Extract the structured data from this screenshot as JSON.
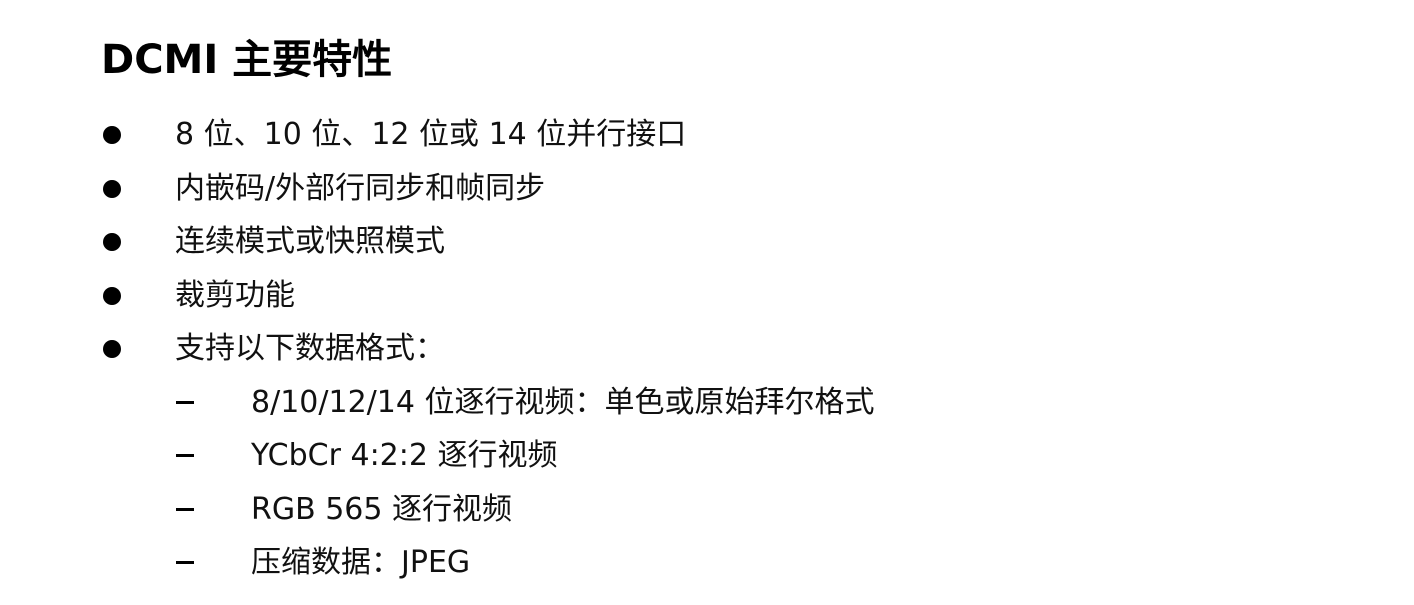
{
  "title": "DCMI 主要特性",
  "items": [
    {
      "level": 1,
      "text": "8 位、10 位、12 位或 14 位并行接口"
    },
    {
      "level": 1,
      "text": "内嵌码/外部行同步和帧同步"
    },
    {
      "level": 1,
      "text": "连续模式或快照模式"
    },
    {
      "level": 1,
      "text": "裁剪功能"
    },
    {
      "level": 1,
      "text": "支持以下数据格式："
    },
    {
      "level": 2,
      "text": "8/10/12/14 位逐行视频：单色或原始拜尔格式"
    },
    {
      "level": 2,
      "text": "YCbCr 4:2:2 逐行视频"
    },
    {
      "level": 2,
      "text": "RGB 565 逐行视频"
    },
    {
      "level": 2,
      "text": "压缩数据：JPEG"
    }
  ]
}
